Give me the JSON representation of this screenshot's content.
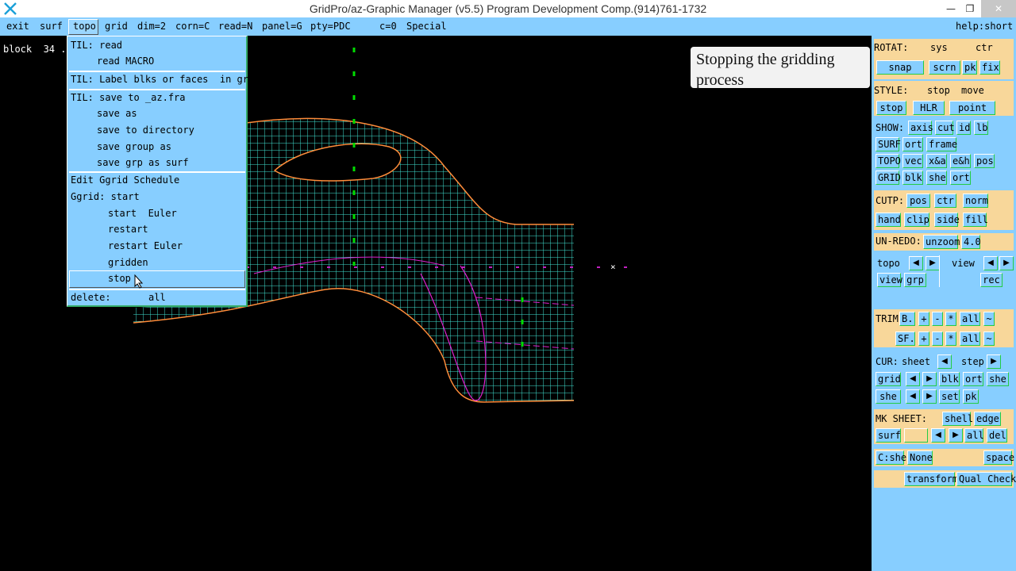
{
  "window": {
    "title": "GridPro/az-Graphic Manager (v5.5)    Program Development Comp.(914)761-1732",
    "minimize_icon": "minimize-icon",
    "maximize_icon": "restore-icon",
    "close_icon": "close-icon"
  },
  "menubar": {
    "items": [
      "exit",
      "surf",
      "topo",
      "grid",
      "dim=2",
      "corn=C",
      "read=N",
      "panel=G",
      "pty=PDC",
      "c=0",
      "Special",
      "help:short"
    ]
  },
  "viewport": {
    "block_label": "block  34 ..",
    "caption": "Stopping the gridding process"
  },
  "dropdown": {
    "til_read": "TIL: read",
    "read_macro": "read MACRO",
    "til_label": "TIL: Label blks or faces  in grp",
    "til_save": "TIL: save to _az.fra",
    "save_as": "save as",
    "save_dir": "save to directory",
    "save_group": "save group as",
    "save_grp_surf": "save grp as surf",
    "edit_sched": "Edit Ggrid Schedule",
    "ggrid_start": "Ggrid: start",
    "start_euler": "start  Euler",
    "restart": "restart",
    "restart_euler": "restart Euler",
    "gridden": "gridden",
    "stop": "stop",
    "delete": "delete:",
    "all": "all"
  },
  "panel": {
    "rotat": {
      "label": "ROTAT:",
      "sys": "sys",
      "ctr": "ctr",
      "snap": "snap",
      "scrn": "scrn",
      "pk": "pk",
      "fix": "fix"
    },
    "style": {
      "label": "STYLE:",
      "stop": "stop",
      "move": "move",
      "stop_btn": "stop",
      "hlr": "HLR",
      "point": "point"
    },
    "show": {
      "label": "SHOW:",
      "axis": "axis",
      "cut": "cut",
      "id": "id",
      "lb": "lb",
      "surf": "SURF",
      "ort": "ort",
      "frame": "frame",
      "topo": "TOPO",
      "vec": "vec",
      "xa": "x&a",
      "eh": "e&h",
      "pos": "pos",
      "grid": "GRID",
      "blk": "blk",
      "she": "she",
      "ort2": "ort"
    },
    "cutp": {
      "label": "CUTP:",
      "pos": "pos",
      "ctr": "ctr",
      "norm": "norm",
      "hand": "hand",
      "clip": "clip",
      "side": "side",
      "fill": "fill"
    },
    "unredo": {
      "label": "UN-REDO:",
      "unzoom": "unzoom",
      "ver": "4.0"
    },
    "nav": {
      "topo": "topo",
      "view": "view",
      "view_btn": "view",
      "grp": "grp",
      "rec": "rec"
    },
    "trim": {
      "label": "TRIM",
      "b": "B.",
      "plus": "+",
      "minus": "-",
      "star": "*",
      "all": "all",
      "tilde": "~",
      "sf": "SF.",
      "plus2": "+",
      "minus2": "-",
      "star2": "*",
      "all2": "all",
      "tilde2": "~"
    },
    "cur": {
      "label": "CUR:",
      "sheet": "sheet",
      "step": "step",
      "grid": "grid",
      "blk": "blk",
      "ort": "ort",
      "she": "she",
      "she2": "she",
      "set": "set",
      "pk": "pk"
    },
    "mksheet": {
      "label": "MK SHEET:",
      "shell": "shell",
      "edge": "edge",
      "surf": "surf",
      "all": "all",
      "del": "del"
    },
    "cshe": {
      "cshe": "C:she",
      "none": "None",
      "space": "space"
    },
    "xform": {
      "transform": "transform",
      "qual": "Qual Check"
    }
  },
  "colors": {
    "menu_bg": "#87ceff",
    "panel_section": "#f8d79a",
    "grid_cyan": "#40e0d0",
    "grid_orange": "#ff8c3a",
    "grid_magenta": "#e020d0",
    "axis_green": "#00dd00"
  }
}
